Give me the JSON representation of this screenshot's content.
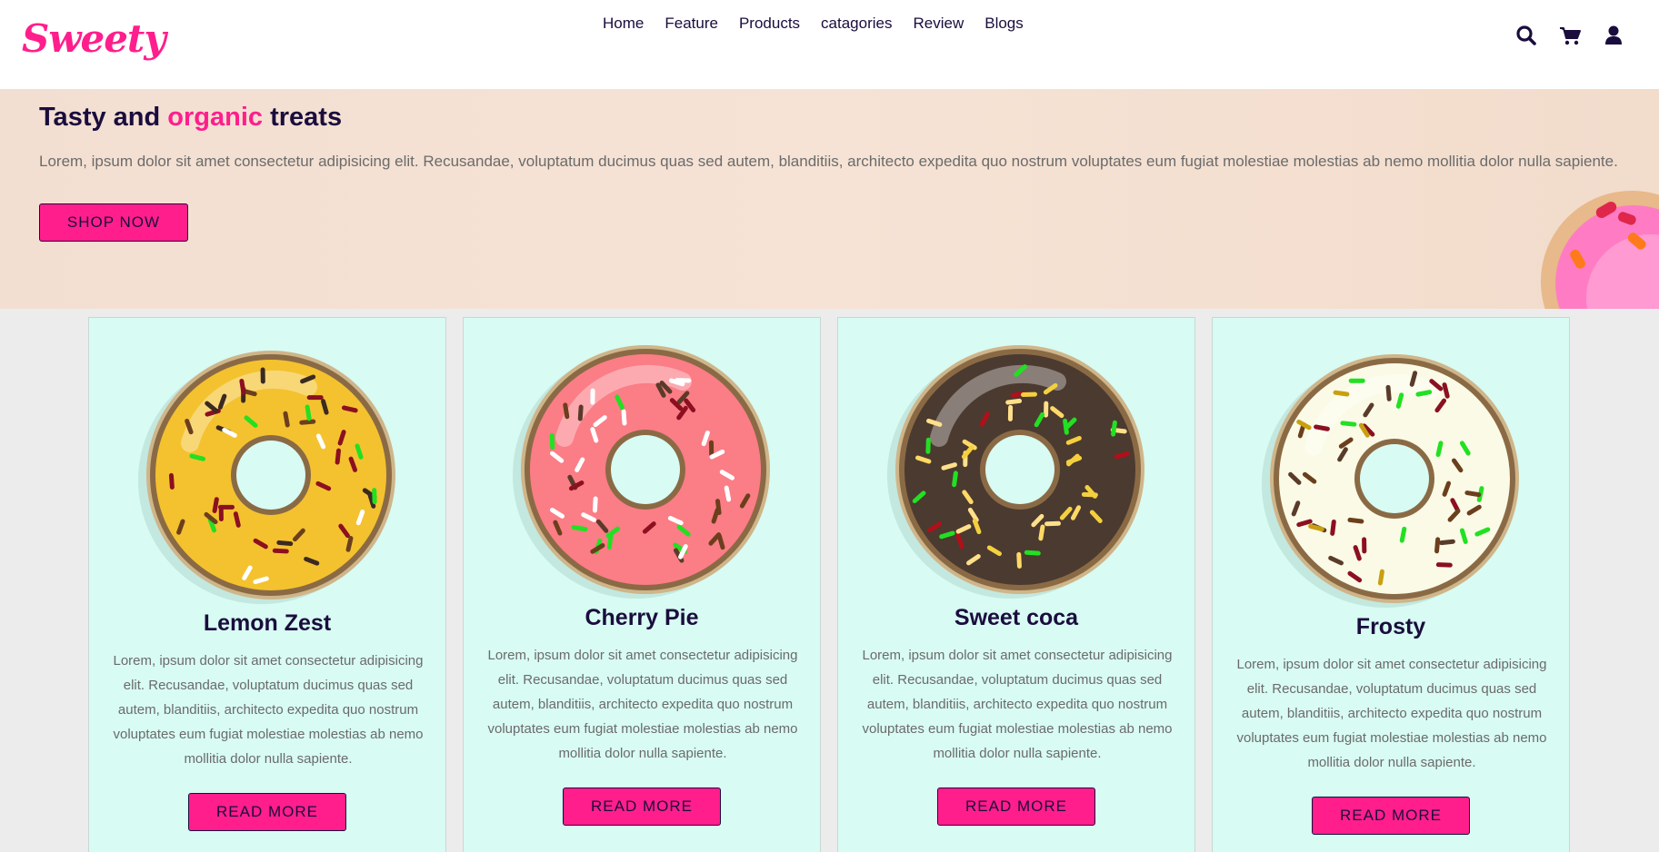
{
  "brand": {
    "logo": "Sweety",
    "accent": "#ff1e8c",
    "ink": "#1a0d3d"
  },
  "nav": [
    "Home",
    "Feature",
    "Products",
    "catagories",
    "Review",
    "Blogs"
  ],
  "header_icons": [
    "search-icon",
    "cart-icon",
    "user-icon"
  ],
  "hero": {
    "title_start": "Tasty and ",
    "title_accent": "organic",
    "title_end": " treats",
    "text": "Lorem, ipsum dolor sit amet consectetur adipisicing elit. Recusandae, voluptatum ducimus quas sed autem, blanditiis, architecto expedita quo nostrum voluptates eum fugiat molestiae molestias ab nemo mollitia dolor nulla sapiente.",
    "button": "SHOP NOW"
  },
  "cards": [
    {
      "title": "Lemon Zest",
      "text": "Lorem, ipsum dolor sit amet consectetur adipisicing elit. Recusandae, voluptatum ducimus quas sed autem, blanditiis, architecto expedita quo nostrum voluptates eum fugiat molestiae molestias ab nemo mollitia dolor nulla sapiente.",
      "button": "READ MORE",
      "icing": "#f4c22f"
    },
    {
      "title": "Cherry Pie",
      "text": "Lorem, ipsum dolor sit amet consectetur adipisicing elit. Recusandae, voluptatum ducimus quas sed autem, blanditiis, architecto expedita quo nostrum voluptates eum fugiat molestiae molestias ab nemo mollitia dolor nulla sapiente.",
      "button": "READ MORE",
      "icing": "#fb7d86"
    },
    {
      "title": "Sweet coca",
      "text": "Lorem, ipsum dolor sit amet consectetur adipisicing elit. Recusandae, voluptatum ducimus quas sed autem, blanditiis, architecto expedita quo nostrum voluptates eum fugiat molestiae molestias ab nemo mollitia dolor nulla sapiente.",
      "button": "READ MORE",
      "icing": "#4b3a30"
    },
    {
      "title": "Frosty",
      "text": "Lorem, ipsum dolor sit amet consectetur adipisicing elit. Recusandae, voluptatum ducimus quas sed autem, blanditiis, architecto expedita quo nostrum voluptates eum fugiat molestiae molestias ab nemo mollitia dolor nulla sapiente.",
      "button": "READ MORE",
      "icing": "#fafae6"
    }
  ]
}
